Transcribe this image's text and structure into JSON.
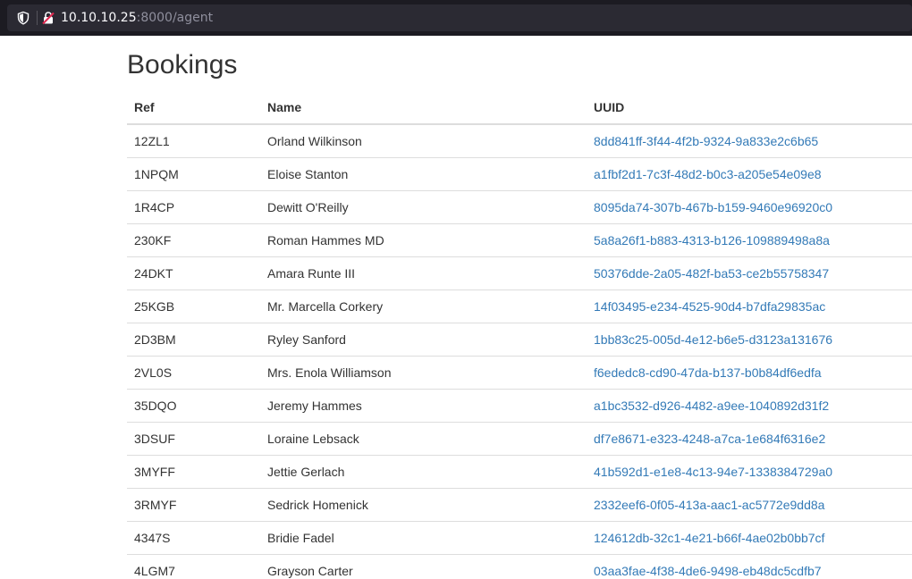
{
  "browser": {
    "url_host": "10.10.10.25",
    "url_rest": ":8000/agent"
  },
  "page": {
    "title": "Bookings"
  },
  "table": {
    "headers": {
      "ref": "Ref",
      "name": "Name",
      "uuid": "UUID"
    },
    "rows": [
      {
        "ref": "12ZL1",
        "name": "Orland Wilkinson",
        "uuid": "8dd841ff-3f44-4f2b-9324-9a833e2c6b65"
      },
      {
        "ref": "1NPQM",
        "name": "Eloise Stanton",
        "uuid": "a1fbf2d1-7c3f-48d2-b0c3-a205e54e09e8"
      },
      {
        "ref": "1R4CP",
        "name": "Dewitt O'Reilly",
        "uuid": "8095da74-307b-467b-b159-9460e96920c0"
      },
      {
        "ref": "230KF",
        "name": "Roman Hammes MD",
        "uuid": "5a8a26f1-b883-4313-b126-109889498a8a"
      },
      {
        "ref": "24DKT",
        "name": "Amara Runte III",
        "uuid": "50376dde-2a05-482f-ba53-ce2b55758347"
      },
      {
        "ref": "25KGB",
        "name": "Mr. Marcella Corkery",
        "uuid": "14f03495-e234-4525-90d4-b7dfa29835ac"
      },
      {
        "ref": "2D3BM",
        "name": "Ryley Sanford",
        "uuid": "1bb83c25-005d-4e12-b6e5-d3123a131676"
      },
      {
        "ref": "2VL0S",
        "name": "Mrs. Enola Williamson",
        "uuid": "f6ededc8-cd90-47da-b137-b0b84df6edfa"
      },
      {
        "ref": "35DQO",
        "name": "Jeremy Hammes",
        "uuid": "a1bc3532-d926-4482-a9ee-1040892d31f2"
      },
      {
        "ref": "3DSUF",
        "name": "Loraine Lebsack",
        "uuid": "df7e8671-e323-4248-a7ca-1e684f6316e2"
      },
      {
        "ref": "3MYFF",
        "name": "Jettie Gerlach",
        "uuid": "41b592d1-e1e8-4c13-94e7-1338384729a0"
      },
      {
        "ref": "3RMYF",
        "name": "Sedrick Homenick",
        "uuid": "2332eef6-0f05-413a-aac1-ac5772e9dd8a"
      },
      {
        "ref": "4347S",
        "name": "Bridie Fadel",
        "uuid": "124612db-32c1-4e21-b66f-4ae02b0bb7cf"
      },
      {
        "ref": "4LGM7",
        "name": "Grayson Carter",
        "uuid": "03aa3fae-4f38-4de6-9498-eb48dc5cdfb7"
      }
    ]
  }
}
